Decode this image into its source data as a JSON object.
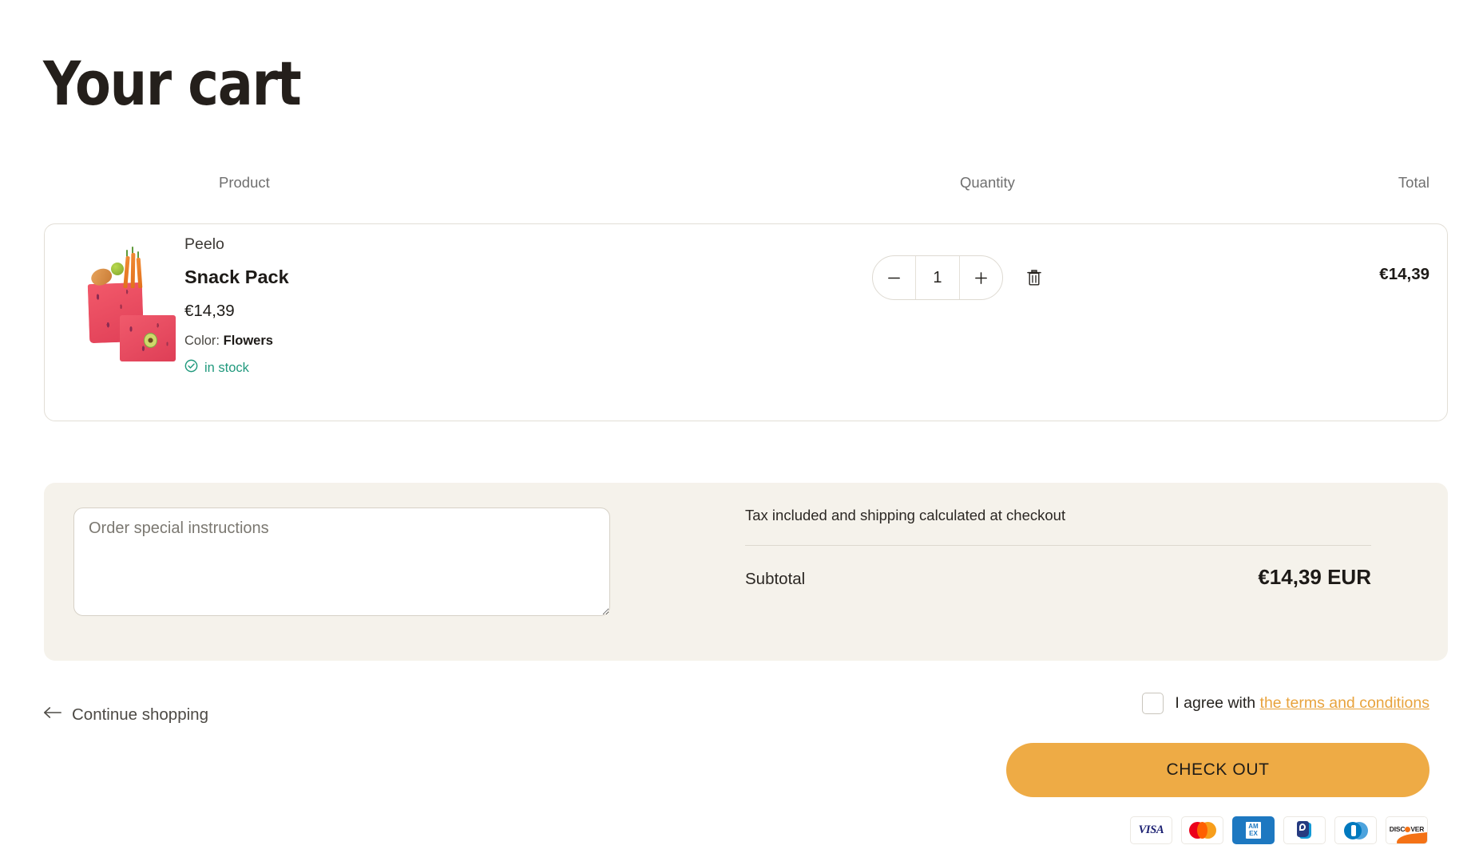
{
  "page": {
    "title": "Your cart"
  },
  "table": {
    "headers": {
      "product": "Product",
      "quantity": "Quantity",
      "total": "Total"
    }
  },
  "line_items": [
    {
      "vendor": "Peelo",
      "name": "Snack Pack",
      "price": "€14,39",
      "variant_label": "Color:",
      "variant_value": "Flowers",
      "stock_status": "in stock",
      "stock_icon": "check-circle-icon",
      "quantity": "1",
      "decrease_label": "−",
      "increase_label": "+",
      "remove_icon": "trash-icon",
      "line_total": "€14,39",
      "image_alt": "snack-pack-thumbnail"
    }
  ],
  "notes": {
    "placeholder": "Order special instructions",
    "value": ""
  },
  "summary": {
    "tax_note": "Tax included and shipping calculated at checkout",
    "subtotal_label": "Subtotal",
    "subtotal_value": "€14,39 EUR"
  },
  "actions": {
    "continue_shopping": "Continue shopping",
    "back_arrow_icon": "arrow-left-icon",
    "terms_prefix": "I agree with",
    "terms_link": "the terms and conditions",
    "terms_checked": false,
    "checkout": "CHECK OUT"
  },
  "payment_methods": [
    {
      "name": "visa",
      "label": "VISA"
    },
    {
      "name": "mastercard",
      "label": "Mastercard"
    },
    {
      "name": "amex",
      "label": "AMEX"
    },
    {
      "name": "paypal",
      "label": "PayPal"
    },
    {
      "name": "diners-club",
      "label": "Diners Club"
    },
    {
      "name": "discover",
      "label": "DISCOVER"
    }
  ],
  "colors": {
    "accent": "#eeab45",
    "link": "#e8a33d",
    "panel": "#f5f2eb",
    "stock": "#20997d",
    "text": "#1d1a17"
  }
}
